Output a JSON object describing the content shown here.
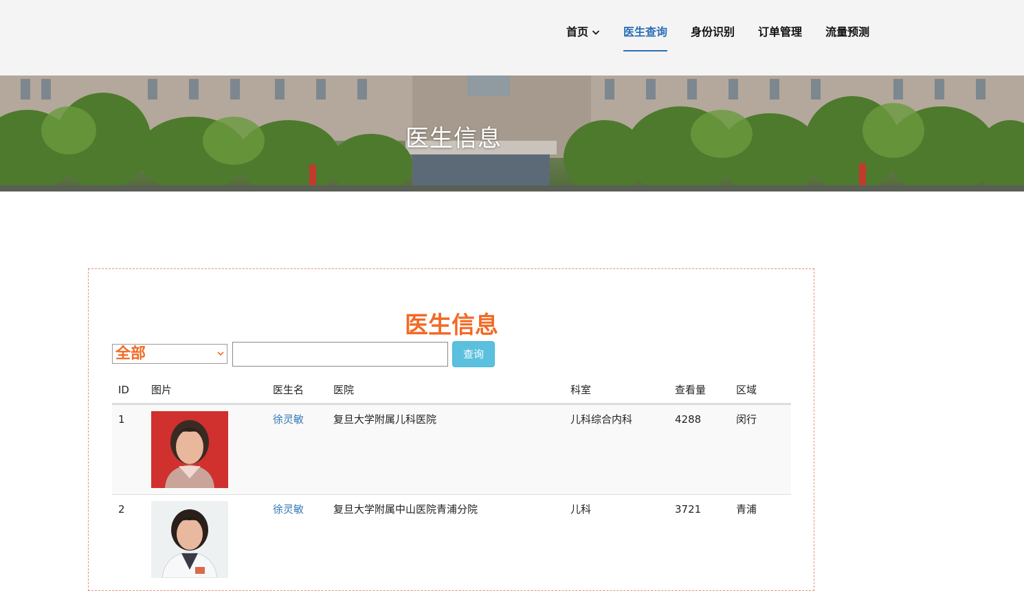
{
  "nav": {
    "items": [
      {
        "label": "首页"
      },
      {
        "label": "医生查询"
      },
      {
        "label": "身份识别"
      },
      {
        "label": "订单管理"
      },
      {
        "label": "流量预测"
      }
    ]
  },
  "banner": {
    "title": "医生信息"
  },
  "panel": {
    "title": "医生信息",
    "filter": {
      "selected": "全部"
    },
    "search": {
      "placeholder": "",
      "button": "查询"
    },
    "table": {
      "headers": [
        "ID",
        "图片",
        "医生名",
        "医院",
        "科室",
        "查看量",
        "区域"
      ],
      "rows": [
        {
          "id": "1",
          "name": "徐灵敏",
          "hospital": "复旦大学附属儿科医院",
          "dept": "儿科综合内科",
          "views": "4288",
          "area": "闵行"
        },
        {
          "id": "2",
          "name": "徐灵敏",
          "hospital": "复旦大学附属中山医院青浦分院",
          "dept": "儿科",
          "views": "3721",
          "area": "青浦"
        }
      ]
    }
  },
  "colors": {
    "accent": "#f26a25",
    "nav_active": "#2a6db5",
    "link": "#337ab7",
    "button": "#5bc0de"
  }
}
